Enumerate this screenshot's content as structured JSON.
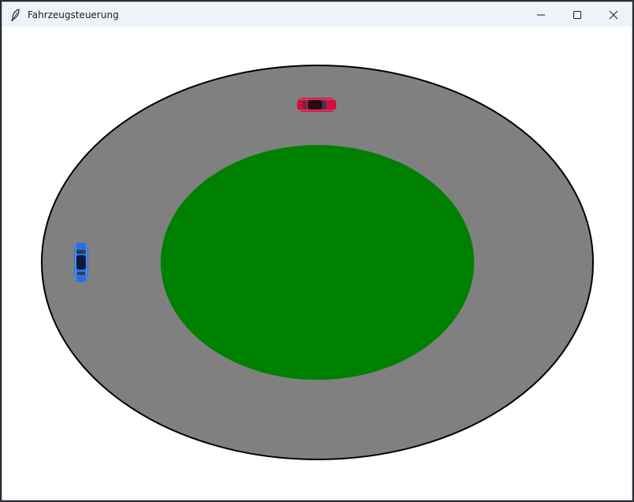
{
  "window": {
    "title": "Fahrzeugsteuerung",
    "icon": "feather-icon",
    "controls": [
      "minimize-icon",
      "maximize-icon",
      "close-icon"
    ]
  },
  "scene": {
    "track_color": "#808080",
    "track_outline_color": "#000000",
    "infield_color": "#008000",
    "background_color": "#ffffff",
    "cars": [
      {
        "name": "red-car",
        "color": "#d01040",
        "orientation": "horizontal"
      },
      {
        "name": "blue-car",
        "color": "#2a6fe0",
        "orientation": "vertical"
      }
    ]
  }
}
